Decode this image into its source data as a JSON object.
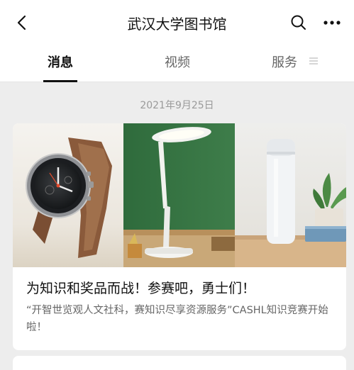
{
  "header": {
    "title": "武汉大学图书馆",
    "back_icon": "chevron-left-icon",
    "search_icon": "search-icon",
    "more_icon": "more-horizontal-icon"
  },
  "tabs": [
    {
      "label": "消息",
      "active": true
    },
    {
      "label": "视频",
      "active": false
    },
    {
      "label": "服务",
      "active": false
    }
  ],
  "feed": {
    "date": "2021年9月25日",
    "article": {
      "title": "为知识和奖品而战！参赛吧，勇士们！",
      "description": "“开智世览观人文社科，赛知识尽享资源服务”CASHL知识竞赛开始啦！",
      "cover_panels": [
        "smartwatch",
        "desk-lamp",
        "thermos-bottle"
      ]
    }
  },
  "colors": {
    "background": "#ededed",
    "surface": "#ffffff",
    "title_text": "#111111",
    "secondary_text": "#666666",
    "muted_text": "#9a9a9a"
  }
}
